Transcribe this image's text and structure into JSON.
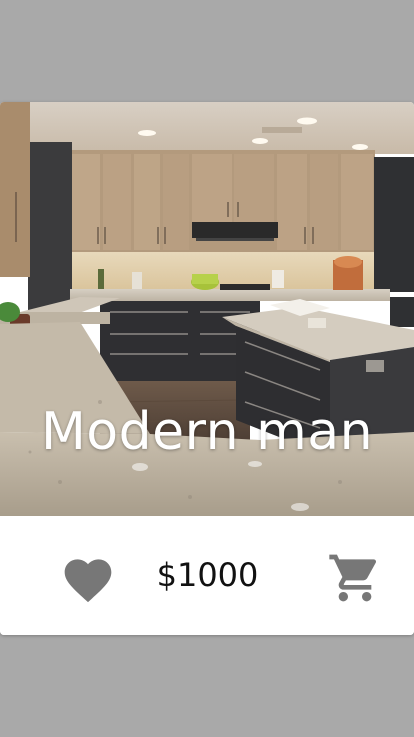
{
  "product": {
    "title": "Modern man",
    "price": "$1000"
  },
  "icons": {
    "like": "heart-icon",
    "cart": "shopping-cart-icon"
  },
  "colors": {
    "background": "#a9a9a9",
    "card": "#ffffff",
    "icon": "#777777",
    "title_text": "#ffffff",
    "price_text": "#111111"
  }
}
